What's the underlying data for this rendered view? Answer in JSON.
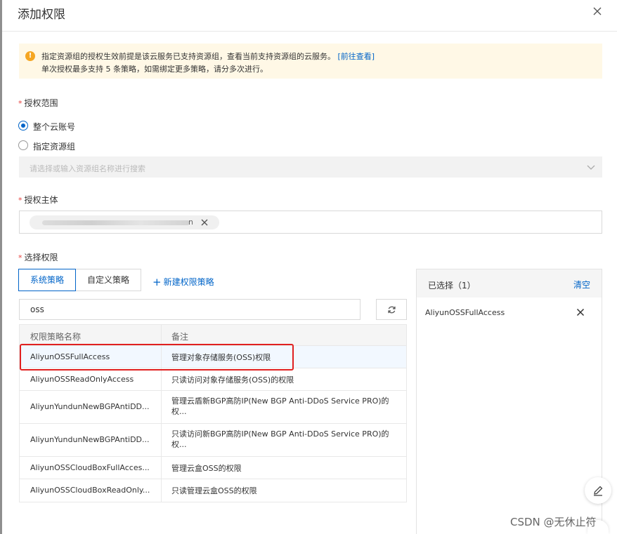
{
  "dialog": {
    "title": "添加权限",
    "close_icon": "close-icon"
  },
  "notice": {
    "line1": "指定资源组的授权生效前提是该云服务已支持资源组，查看当前支持资源组的云服务。",
    "link": "[前往查看]",
    "line2": "单次授权最多支持 5 条策略，如需绑定更多策略，请分多次进行。",
    "icon": "warning-icon",
    "bg_color": "#fff8e6"
  },
  "scope": {
    "label": "授权范围",
    "options": [
      {
        "label": "整个云账号",
        "checked": true
      },
      {
        "label": "指定资源组",
        "checked": false
      }
    ],
    "resource_group_placeholder": "请选择或输入资源组名称进行搜索"
  },
  "principal": {
    "label": "授权主体",
    "tag_tail": "n"
  },
  "permissions": {
    "label": "选择权限",
    "tabs": [
      {
        "label": "系统策略",
        "active": true
      },
      {
        "label": "自定义策略",
        "active": false
      }
    ],
    "new_policy": "新建权限策略",
    "search_value": "oss",
    "columns": {
      "name": "权限策略名称",
      "note": "备注"
    },
    "rows": [
      {
        "name": "AliyunOSSFullAccess",
        "note": "管理对象存储服务(OSS)权限"
      },
      {
        "name": "AliyunOSSReadOnlyAccess",
        "note": "只读访问对象存储服务(OSS)的权限"
      },
      {
        "name": "AliyunYundunNewBGPAntiDD...",
        "note": "管理云盾新BGP高防IP(New BGP Anti-DDoS Service PRO)的权..."
      },
      {
        "name": "AliyunYundunNewBGPAntiDD...",
        "note": "只读访问新BGP高防IP(New BGP Anti-DDoS Service PRO)的权..."
      },
      {
        "name": "AliyunOSSCloudBoxFullAcces...",
        "note": "管理云盒OSS的权限"
      },
      {
        "name": "AliyunOSSCloudBoxReadOnly...",
        "note": "只读管理云盒OSS的权限"
      }
    ]
  },
  "selected": {
    "title": "已选择（1）",
    "clear": "清空",
    "items": [
      "AliyunOSSFullAccess"
    ]
  },
  "watermark": "CSDN @无休止符",
  "colors": {
    "accent": "#0064c8",
    "highlight_box": "#e02020",
    "warning": "#f5a623"
  }
}
